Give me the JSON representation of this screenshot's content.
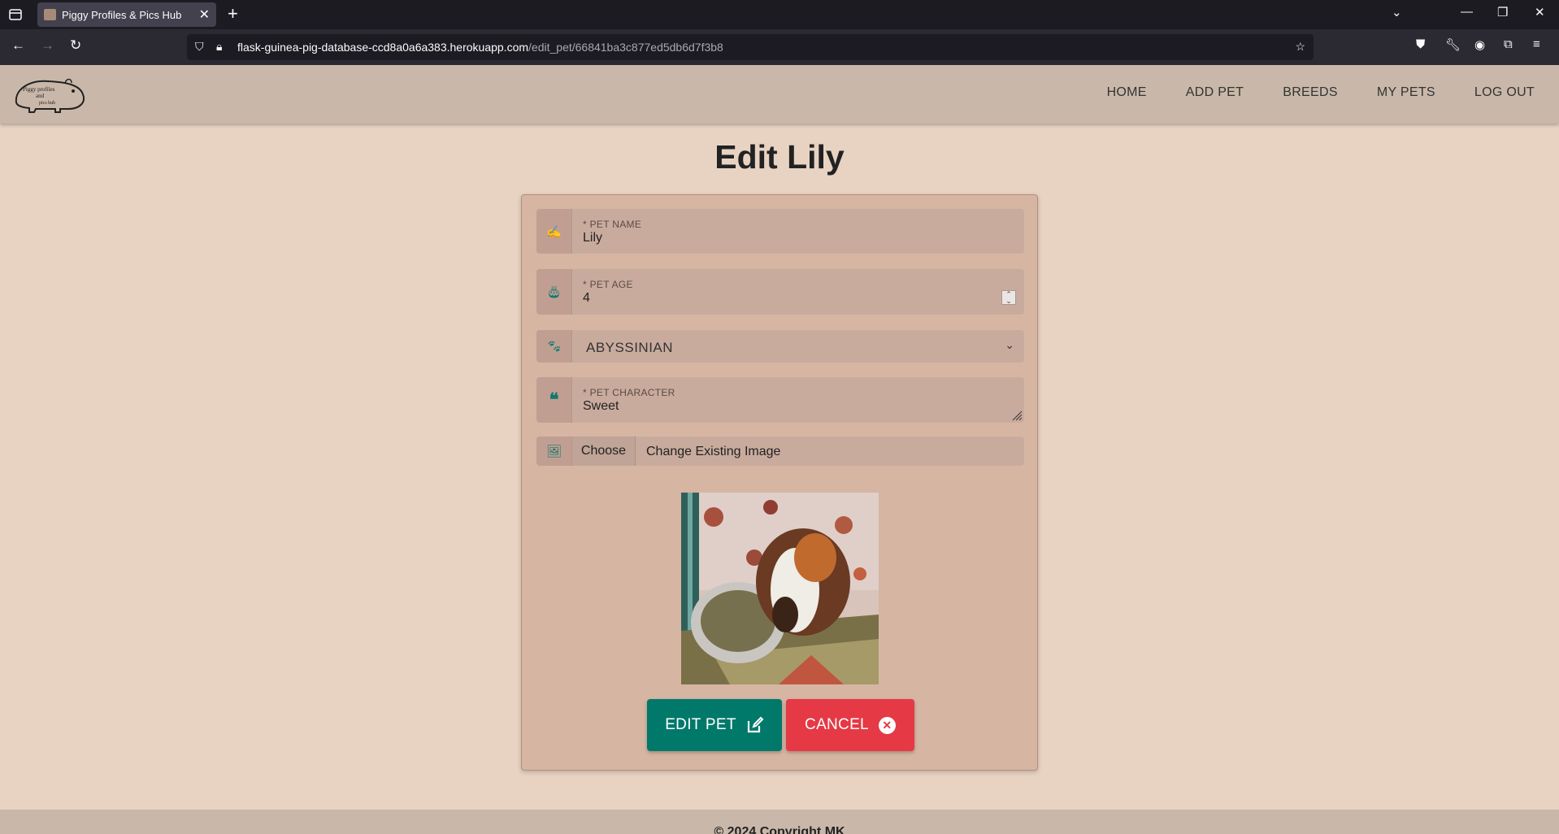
{
  "browser": {
    "tab_title": "Piggy Profiles & Pics Hub",
    "url_host": "flask-guinea-pig-database-ccd8a0a6a383.herokuapp.com",
    "url_path": "/edit_pet/66841ba3c877ed5db6d7f3b8"
  },
  "site": {
    "logo_text": "Piggy profiles and pics hub",
    "nav": [
      "HOME",
      "ADD PET",
      "BREEDS",
      "MY PETS",
      "LOG OUT"
    ]
  },
  "page": {
    "title": "Edit Lily"
  },
  "form": {
    "pet_name": {
      "label": "* PET NAME",
      "value": "Lily"
    },
    "pet_age": {
      "label": "* PET AGE",
      "value": "4"
    },
    "breed": {
      "value": "ABYSSINIAN"
    },
    "pet_character": {
      "label": "* PET CHARACTER",
      "value": "Sweet"
    },
    "image": {
      "choose_label": "Choose",
      "text": "Change Existing Image"
    },
    "edit_button": "EDIT PET",
    "cancel_button": "CANCEL"
  },
  "colors": {
    "accent": "#00796b",
    "danger": "#e53945",
    "header": "#c9b8a9",
    "background": "#e8d3c3"
  },
  "footer": {
    "text": "© 2024 Copyright MK"
  }
}
